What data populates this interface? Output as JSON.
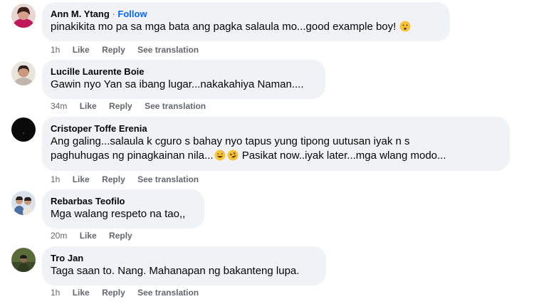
{
  "comments": [
    {
      "author": "Ann M. Ytang",
      "follow_sep": "·",
      "follow": "Follow",
      "text": "pinakikita mo pa sa mga bata ang pagka salaula mo...good example boy!",
      "emoji": "worried-face",
      "time": "1h",
      "like": "Like",
      "reply": "Reply",
      "translate": "See translation"
    },
    {
      "author": "Lucille Laurente Boie",
      "text": "Gawin nyo Yan sa ibang lugar...nakakahiya Naman....",
      "time": "34m",
      "like": "Like",
      "reply": "Reply",
      "translate": "See translation"
    },
    {
      "author": "Cristoper Toffe Erenia",
      "text_line1": "Ang galing...salaula k cguro s bahay nyo tapus yung tipong uutusan iyak n s",
      "text_line2a": "paghuhugas ng pinagkainan nila...",
      "emojis": [
        "grinning-sweat-face",
        "rofl-face"
      ],
      "text_line2b": "Pasikat now..iyak later...mga wlang modo...",
      "time": "1h",
      "like": "Like",
      "reply": "Reply",
      "translate": "See translation"
    },
    {
      "author": "Rebarbas Teofilo",
      "text": "Mga walang respeto na tao,,",
      "time": "20m",
      "like": "Like",
      "reply": "Reply"
    },
    {
      "author": "Tro Jan",
      "text": "Taga saan to. Nang. Mahanapan ng bakanteng lupa.",
      "time": "1h",
      "like": "Like",
      "reply": "Reply",
      "translate": "See translation"
    }
  ],
  "colors": {
    "bubble": "#f0f2f5",
    "follow": "#0866ff",
    "meta": "#65676b",
    "emoji": "#f7c33b"
  }
}
